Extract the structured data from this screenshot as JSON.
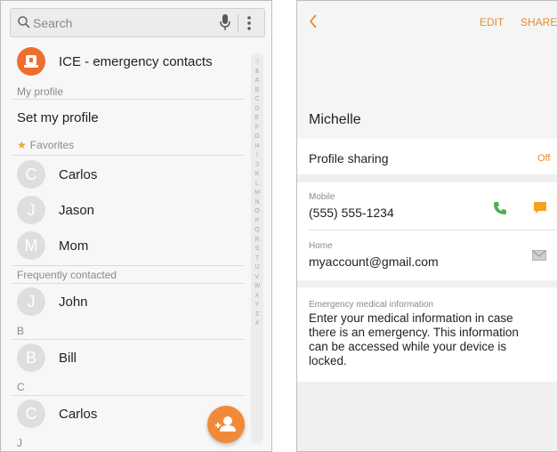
{
  "left_phone": {
    "search": {
      "placeholder": "Search"
    },
    "ice": {
      "label": "ICE - emergency contacts"
    },
    "sections": {
      "my_profile": "My profile",
      "set_profile": "Set my profile",
      "favorites": "Favorites",
      "frequently": "Frequently contacted",
      "b": "B",
      "c": "C",
      "j": "J"
    },
    "favorites": [
      {
        "initial": "C",
        "name": "Carlos"
      },
      {
        "initial": "J",
        "name": "Jason"
      },
      {
        "initial": "M",
        "name": "Mom"
      }
    ],
    "frequent": [
      {
        "initial": "J",
        "name": "John"
      }
    ],
    "b_contacts": [
      {
        "initial": "B",
        "name": "Bill"
      }
    ],
    "c_contacts": [
      {
        "initial": "C",
        "name": "Carlos"
      }
    ],
    "index_letters": [
      "☆",
      "&",
      "A",
      "B",
      "C",
      "D",
      "E",
      "F",
      "G",
      "H",
      "I",
      "J",
      "K",
      "L",
      "M",
      "N",
      "O",
      "P",
      "Q",
      "R",
      "S",
      "T",
      "U",
      "V",
      "W",
      "X",
      "Y",
      "Z",
      "#"
    ]
  },
  "right_phone": {
    "toolbar": {
      "edit": "EDIT",
      "share": "SHARE"
    },
    "name": "Michelle",
    "profile_sharing": {
      "label": "Profile sharing",
      "value": "Off"
    },
    "mobile": {
      "label": "Mobile",
      "value": "(555) 555-1234"
    },
    "home": {
      "label": "Home",
      "value": "myaccount@gmail.com"
    },
    "emergency": {
      "label": "Emergency medical information",
      "text": "Enter your medical information in case there is an emergency. This information can be accessed while your device is locked."
    }
  },
  "colors": {
    "accent_orange": "#ee6e2f",
    "call_green": "#4caf50",
    "message_orange": "#f4a223"
  }
}
